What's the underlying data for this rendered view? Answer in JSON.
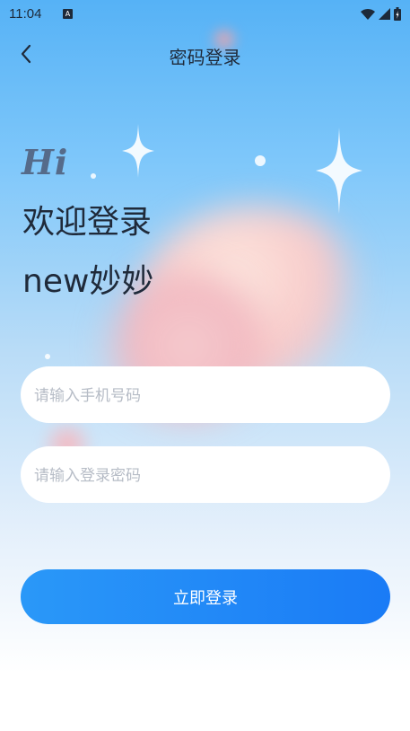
{
  "status_bar": {
    "time": "11:04",
    "notification_icon": "A"
  },
  "nav": {
    "title": "密码登录",
    "back_icon": "chevron-left-icon"
  },
  "greeting": {
    "hi": "Hi",
    "welcome": "欢迎登录",
    "app_name": "new妙妙"
  },
  "form": {
    "phone_placeholder": "请输入手机号码",
    "password_placeholder": "请输入登录密码",
    "phone_value": "",
    "password_value": ""
  },
  "login_button": {
    "label": "立即登录"
  },
  "colors": {
    "accent": "#1a7bf6",
    "text_dark": "#1f2a3a",
    "placeholder": "#b6bcc6"
  }
}
